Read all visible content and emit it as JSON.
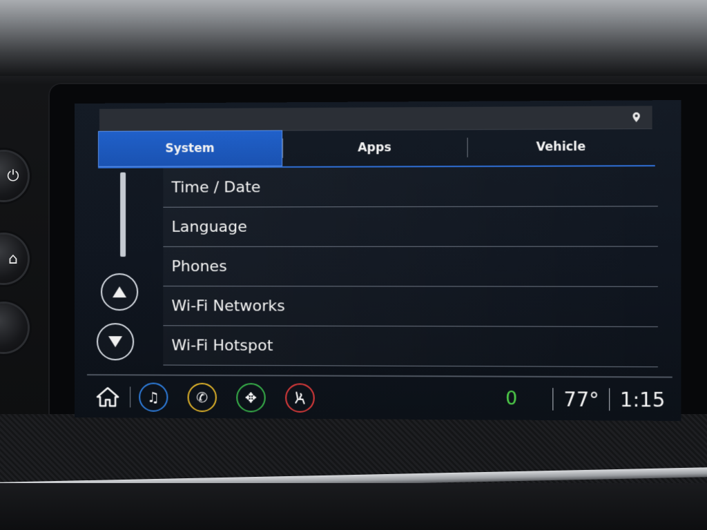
{
  "tabs": [
    {
      "label": "System",
      "active": true
    },
    {
      "label": "Apps",
      "active": false
    },
    {
      "label": "Vehicle",
      "active": false
    }
  ],
  "menu": {
    "items": [
      {
        "label": "Time / Date"
      },
      {
        "label": "Language"
      },
      {
        "label": "Phones"
      },
      {
        "label": "Wi-Fi Networks"
      },
      {
        "label": "Wi-Fi Hotspot"
      }
    ]
  },
  "scroll": {
    "position_fraction": 0.0
  },
  "bottom_bar": {
    "apps": [
      {
        "name": "home-icon"
      },
      {
        "name": "music-icon",
        "color": "#2f7fe0"
      },
      {
        "name": "phone-icon",
        "color": "#e2b52a"
      },
      {
        "name": "navigation-icon",
        "color": "#38b24a"
      },
      {
        "name": "seat-climate-icon",
        "color": "#dd3b3b"
      }
    ],
    "notification_count": "0",
    "temperature": "77°",
    "clock": "1:15"
  },
  "colors": {
    "accent": "#2060c9",
    "counter": "#4fd14a"
  }
}
